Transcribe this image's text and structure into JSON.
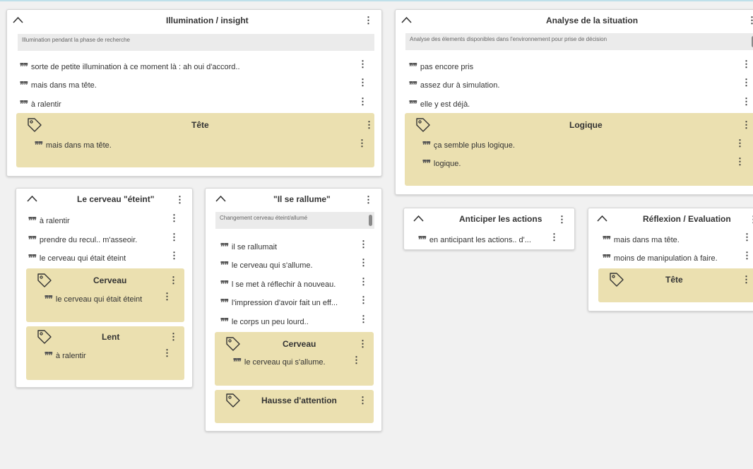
{
  "cards": {
    "illumination": {
      "title": "Illumination / insight",
      "description": "Illumination pendant la phase de recherche",
      "quotes": [
        "sorte de petite illumination à ce moment là : ah oui d'accord..",
        "mais dans ma tête.",
        "à ralentir"
      ],
      "tags": [
        {
          "title": "Tête",
          "quotes": [
            "mais dans ma tête."
          ]
        }
      ]
    },
    "analyse": {
      "title": "Analyse de la situation",
      "description": "Analyse des élements disponibles dans l'environnement pour prise de décision",
      "quotes": [
        "pas encore pris",
        "assez dur à simulation.",
        "elle y est déjà."
      ],
      "tags": [
        {
          "title": "Logique",
          "quotes": [
            "ça semble plus logique.",
            "logique."
          ]
        }
      ]
    },
    "cerveau_eteint": {
      "title": "Le cerveau \"éteint\"",
      "quotes": [
        "à ralentir",
        "prendre du recul.. m'asseoir.",
        "le cerveau qui était éteint"
      ],
      "tags": [
        {
          "title": "Cerveau",
          "quotes": [
            "le cerveau qui était éteint"
          ]
        },
        {
          "title": "Lent",
          "quotes": [
            "à ralentir"
          ]
        }
      ]
    },
    "rallume": {
      "title": "\"Il se rallume\"",
      "description": "Changement cerveau éteint/allumé",
      "quotes": [
        "il se rallumait",
        "le cerveau qui s'allume.",
        "l se met à réflechir à nouveau.",
        "l'impression d'avoir fait un eff...",
        "le corps un peu lourd.."
      ],
      "tags": [
        {
          "title": "Cerveau",
          "quotes": [
            "le cerveau qui s'allume."
          ]
        },
        {
          "title": "Hausse d'attention",
          "quotes": []
        }
      ]
    },
    "anticiper": {
      "title": "Anticiper les actions",
      "quotes": [
        "en anticipant les actions.. d'..."
      ]
    },
    "reflexion": {
      "title": "Réflexion  / Evaluation",
      "quotes": [
        "mais dans ma tête.",
        "moins de manipulation à faire."
      ],
      "tags": [
        {
          "title": "Tête",
          "quotes": []
        }
      ]
    }
  },
  "icons": {
    "collapse": "chevron-up-icon",
    "menu": "kebab-menu-icon",
    "quote": "quote-icon",
    "tag": "tag-icon",
    "quote_glyph": "❞❞"
  },
  "colors": {
    "tag_background": "#ebe0b0",
    "description_background": "#ebebeb",
    "card_background": "#ffffff",
    "page_background": "#f1f1f1"
  }
}
